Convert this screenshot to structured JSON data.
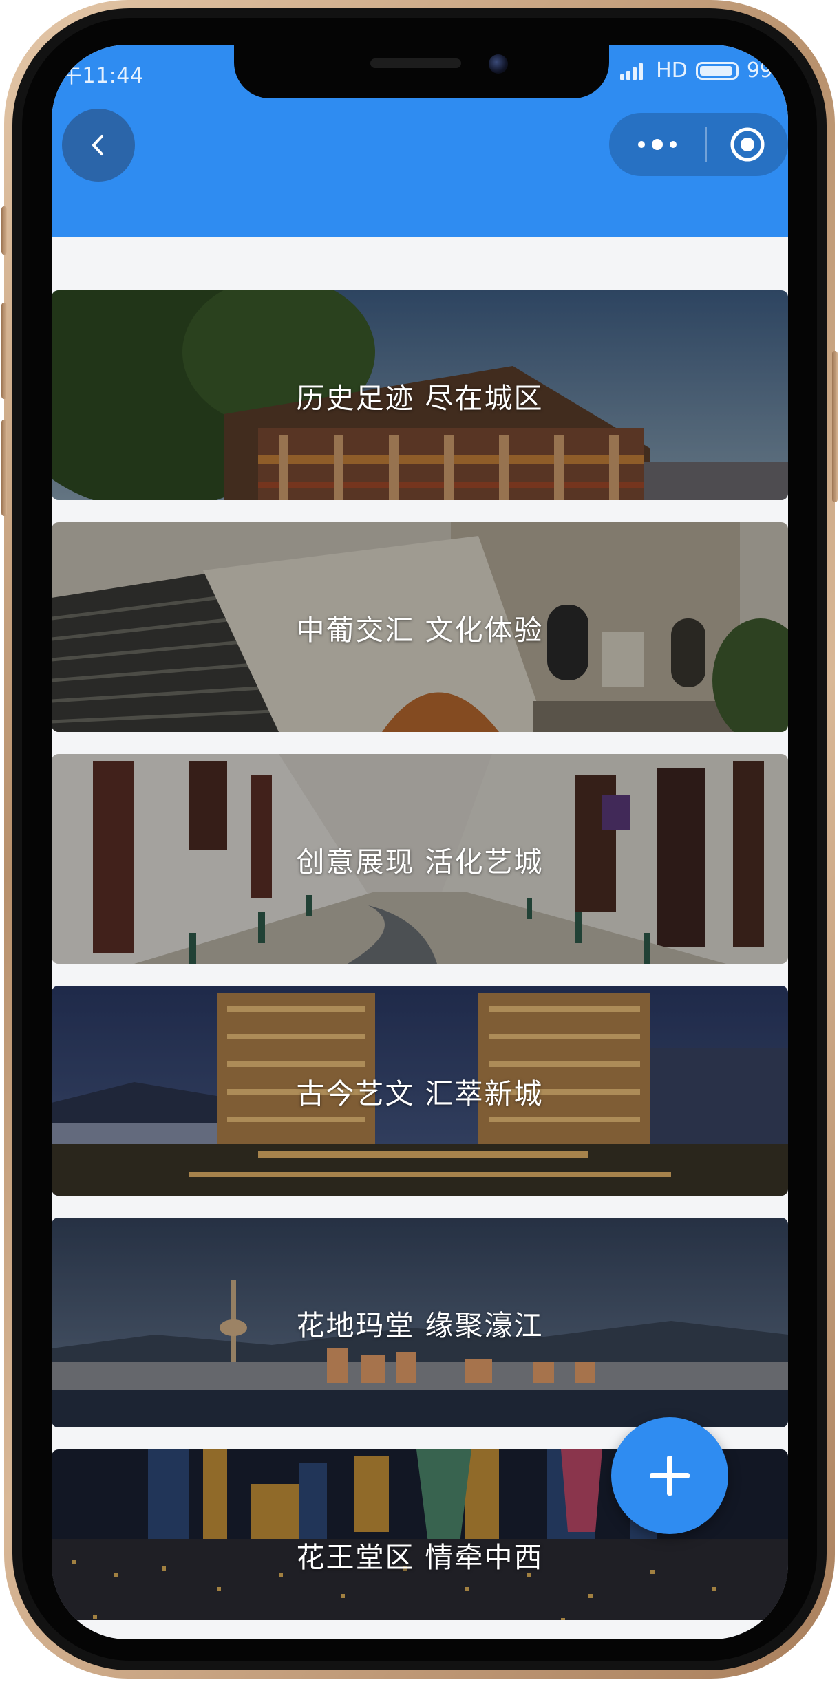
{
  "status_bar": {
    "time": "午11:44",
    "network": "HD",
    "battery": "99"
  },
  "nav": {
    "back_icon": "chevron-left-icon",
    "more_icon": "more-dots-icon",
    "close_icon": "target-circle-icon"
  },
  "cards": [
    {
      "title": "历史足迹 尽在城区",
      "scene": "historic-colonial-building"
    },
    {
      "title": "中葡交汇 文化体验",
      "scene": "stone-staircase-facade"
    },
    {
      "title": "创意展现 活化艺城",
      "scene": "cobblestone-street"
    },
    {
      "title": "古今艺文 汇萃新城",
      "scene": "night-hotel-towers"
    },
    {
      "title": "花地玛堂 缘聚濠江",
      "scene": "tower-waterfront-dusk"
    },
    {
      "title": "花王堂区 情牵中西",
      "scene": "city-night-skyline"
    }
  ],
  "fab": {
    "icon": "plus-icon"
  },
  "colors": {
    "brand_blue": "#2f8cf1",
    "page_bg": "#f4f5f7",
    "phone_gold": "#c9a27f"
  }
}
